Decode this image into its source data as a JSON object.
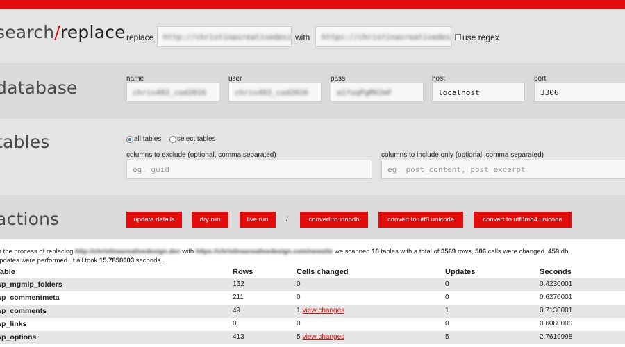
{
  "search_replace": {
    "title_pre": "search",
    "title_slash": "/",
    "title_post": "replace",
    "replace_label": "replace",
    "replace_value": "http://christinasreativedesign.dev",
    "with_label": "with",
    "with_value": "https://christinasreativedesign.com/newsite",
    "use_regex_label": "use regex"
  },
  "database": {
    "title": "database",
    "name_label": "name",
    "name_value": "chris493_cod2016",
    "user_label": "user",
    "user_value": "chris493_cod2016",
    "pass_label": "pass",
    "pass_value": "a1foqPgMV2mF",
    "host_label": "host",
    "host_value": "localhost",
    "port_label": "port",
    "port_value": "3306"
  },
  "tables": {
    "title": "tables",
    "all_tables_label": "all tables",
    "select_tables_label": "select tables",
    "exclude_label": "columns to exclude (optional, comma separated)",
    "exclude_placeholder": "eg. guid",
    "include_label": "columns to include only (optional, comma separated)",
    "include_placeholder": "eg. post_content, post_excerpt"
  },
  "actions": {
    "title": "actions",
    "update_details": "update details",
    "dry_run": "dry run",
    "live_run": "live run",
    "separator": "/",
    "convert_innodb": "convert to innodb",
    "convert_utf8": "convert to utf8 unicode",
    "convert_utf8mb4": "convert to utf8mb4 unicode"
  },
  "summary": {
    "t1": "In the process of replacing ",
    "from": "http://christinasreativedesign.dev",
    "t2": " with ",
    "to": "https://christinasreativedesign.com/newsite",
    "t3": " we scanned ",
    "tables": "18",
    "t4": " tables with a total of ",
    "rows": "3569",
    "t5": " rows, ",
    "cells": "506",
    "t6": " cells were changed. ",
    "updates": "459",
    "t7": " db",
    "t8": "updates were performed. It all took ",
    "seconds": "15.7850003",
    "t9": " seconds."
  },
  "results": {
    "headers": [
      "Table",
      "Rows",
      "Cells changed",
      "Updates",
      "Seconds"
    ],
    "view_changes_label": "view changes",
    "rows": [
      {
        "table": "wp_mgmlp_folders",
        "rows": "162",
        "cells": "0",
        "has_link": false,
        "updates": "0",
        "seconds": "0.4230001"
      },
      {
        "table": "wp_commentmeta",
        "rows": "211",
        "cells": "0",
        "has_link": false,
        "updates": "0",
        "seconds": "0.6270001"
      },
      {
        "table": "wp_comments",
        "rows": "49",
        "cells": "1",
        "has_link": true,
        "updates": "1",
        "seconds": "0.7130001"
      },
      {
        "table": "wp_links",
        "rows": "0",
        "cells": "0",
        "has_link": false,
        "updates": "0",
        "seconds": "0.6080000"
      },
      {
        "table": "wp_options",
        "rows": "413",
        "cells": "5",
        "has_link": true,
        "updates": "5",
        "seconds": "2.7619998"
      }
    ]
  },
  "colors": {
    "accent": "#e20e0e",
    "band_light": "#e4e4e4",
    "band_dark": "#dadada"
  }
}
